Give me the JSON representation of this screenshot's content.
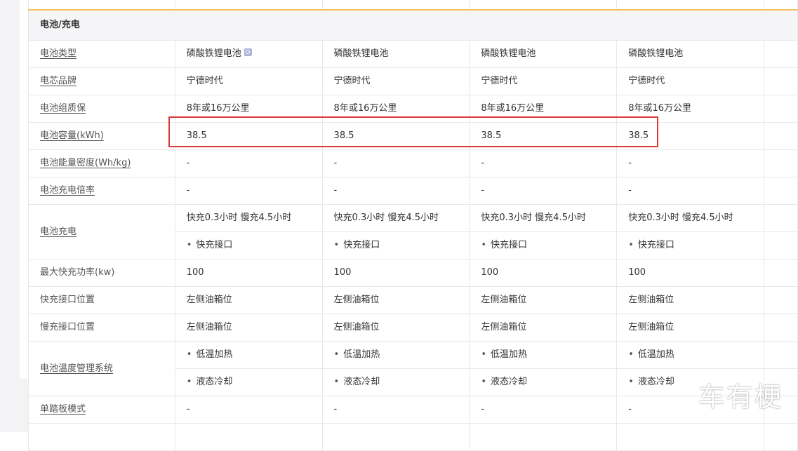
{
  "section_title": "电池/充电",
  "rows": [
    {
      "label": "电池类型",
      "values": [
        "磷酸铁锂电池",
        "磷酸铁锂电池",
        "磷酸铁锂电池",
        "磷酸铁锂电池"
      ]
    },
    {
      "label": "电芯品牌",
      "values": [
        "宁德时代",
        "宁德时代",
        "宁德时代",
        "宁德时代"
      ]
    },
    {
      "label": "电池组质保",
      "values": [
        "8年或16万公里",
        "8年或16万公里",
        "8年或16万公里",
        "8年或16万公里"
      ]
    },
    {
      "label": "电池容量(kWh)",
      "values": [
        "38.5",
        "38.5",
        "38.5",
        "38.5"
      ]
    },
    {
      "label": "电池能量密度(Wh/kg)",
      "values": [
        "-",
        "-",
        "-",
        "-"
      ]
    },
    {
      "label": "电池充电倍率",
      "values": [
        "-",
        "-",
        "-",
        "-"
      ]
    },
    {
      "label": "电池充电",
      "values": [
        "快充0.3小时 慢充4.5小时",
        "快充0.3小时 慢充4.5小时",
        "快充0.3小时 慢充4.5小时",
        "快充0.3小时 慢充4.5小时"
      ],
      "bullets": [
        "快充接口",
        "快充接口",
        "快充接口",
        "快充接口"
      ]
    },
    {
      "label": "最大快充功率(kw)",
      "values": [
        "100",
        "100",
        "100",
        "100"
      ]
    },
    {
      "label": "快充接口位置",
      "values": [
        "左侧油箱位",
        "左侧油箱位",
        "左侧油箱位",
        "左侧油箱位"
      ]
    },
    {
      "label": "慢充接口位置",
      "values": [
        "左侧油箱位",
        "左侧油箱位",
        "左侧油箱位",
        "左侧油箱位"
      ]
    },
    {
      "label": "电池温度管理系统",
      "bullets_a": [
        "低温加热",
        "低温加热",
        "低温加热",
        "低温加热"
      ],
      "bullets_b": [
        "液态冷却",
        "液态冷却",
        "液态冷却",
        "液态冷却"
      ]
    },
    {
      "label": "单踏板模式",
      "values": [
        "-",
        "-",
        "-",
        "-"
      ]
    }
  ],
  "highlight_color": "#d93a3a",
  "accent_border_color": "#f2c25a",
  "watermark": "车有梗",
  "icons": {
    "battery_type_search": "search-icon"
  }
}
